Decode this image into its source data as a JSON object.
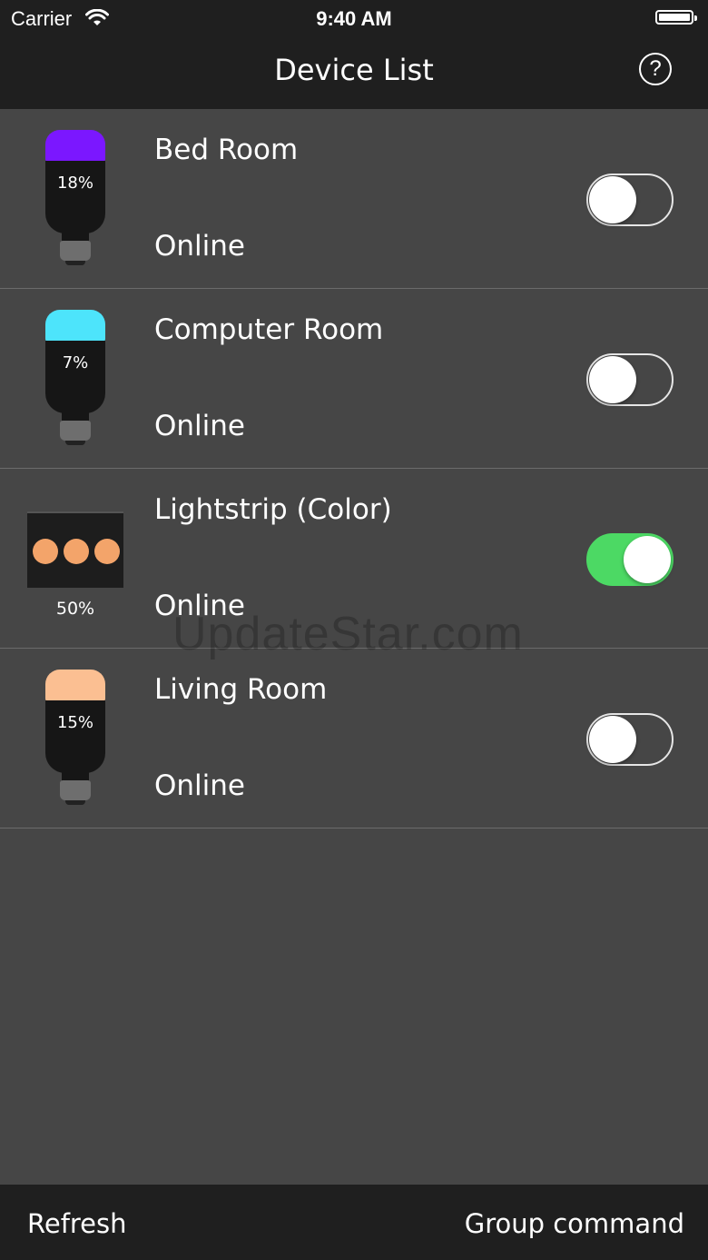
{
  "status_bar": {
    "carrier": "Carrier",
    "time": "9:40 AM",
    "wifi_icon": "wifi-icon",
    "battery_icon": "battery-icon"
  },
  "nav": {
    "title": "Device List",
    "help_label": "?",
    "help_icon": "question-circle-icon"
  },
  "devices": [
    {
      "name": "Bed Room",
      "status": "Online",
      "type": "bulb",
      "brightness": "18%",
      "color": "#7b17ff",
      "on": false
    },
    {
      "name": "Computer Room",
      "status": "Online",
      "type": "bulb",
      "brightness": "7%",
      "color": "#4de4fb",
      "on": false
    },
    {
      "name": "Lightstrip (Color)",
      "status": "Online",
      "type": "lightstrip",
      "brightness": "50%",
      "color": "#f3a46a",
      "on": true
    },
    {
      "name": "Living Room",
      "status": "Online",
      "type": "bulb",
      "brightness": "15%",
      "color": "#fbbf92",
      "on": false
    }
  ],
  "watermark": "UpdateStar.com",
  "toolbar": {
    "refresh_label": "Refresh",
    "group_label": "Group command"
  },
  "colors": {
    "background": "#464646",
    "bar": "#1f1f1f",
    "toggle_on": "#4cd964"
  }
}
